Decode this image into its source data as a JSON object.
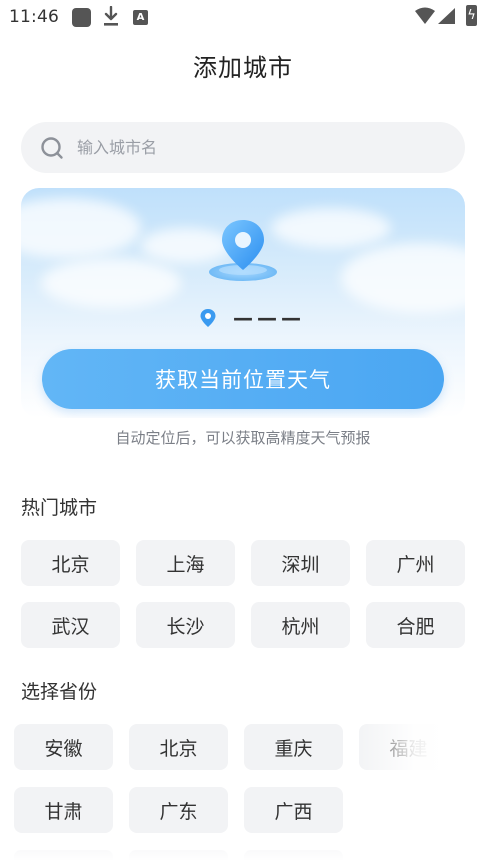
{
  "status_bar": {
    "time": "11:46",
    "a_badge": "A",
    "icons": [
      "square-notification-icon",
      "download-icon",
      "a-badge-icon",
      "wifi-icon",
      "signal-icon",
      "battery-icon"
    ]
  },
  "header": {
    "title": "添加城市"
  },
  "search": {
    "placeholder": "输入城市名",
    "value": ""
  },
  "location_card": {
    "current_location": "———",
    "button_label": "获取当前位置天气",
    "hint": "自动定位后，可以获取高精度天气预报",
    "accent_color": "#4aa6f2"
  },
  "hot_cities": {
    "title": "热门城市",
    "items": [
      "北京",
      "上海",
      "深圳",
      "广州",
      "武汉",
      "长沙",
      "杭州",
      "合肥"
    ]
  },
  "provinces": {
    "title": "选择省份",
    "items": [
      "安徽",
      "北京",
      "重庆",
      "福建",
      "甘肃",
      "广东",
      "广西"
    ]
  }
}
